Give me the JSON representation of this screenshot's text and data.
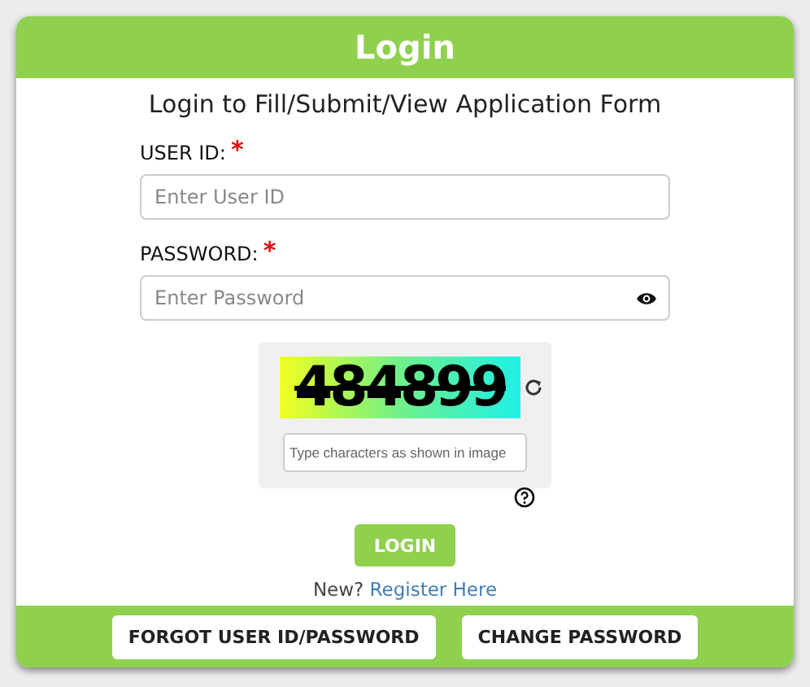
{
  "header": {
    "title": "Login"
  },
  "subtitle": "Login to Fill/Submit/View Application Form",
  "fields": [
    {
      "label": "USER ID:",
      "required_mark": "*",
      "placeholder": "Enter User ID",
      "kind": "text"
    },
    {
      "label": "PASSWORD:",
      "required_mark": "*",
      "placeholder": "Enter Password",
      "kind": "password"
    }
  ],
  "captcha": {
    "code": "484899",
    "placeholder": "Type characters as shown in image"
  },
  "login_button": "LOGIN",
  "register": {
    "prompt": "New?",
    "link": "Register Here"
  },
  "footer_buttons": [
    "FORGOT USER ID/PASSWORD",
    "CHANGE PASSWORD"
  ]
}
